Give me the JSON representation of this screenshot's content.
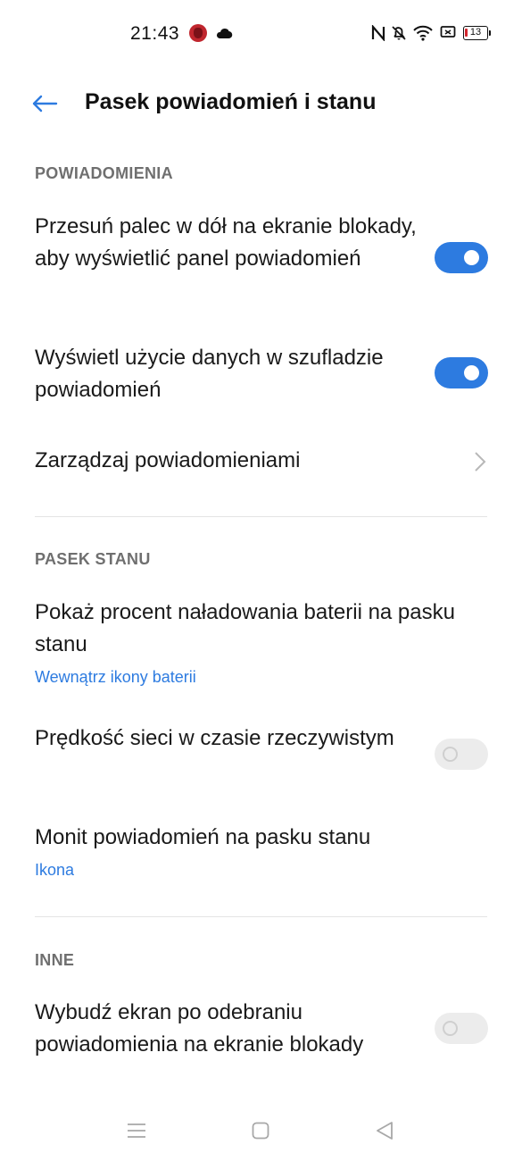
{
  "status_bar": {
    "time": "21:43",
    "battery_level": "13",
    "icons": [
      "game-app-icon",
      "cloud-icon",
      "nfc-icon",
      "bell-off-icon",
      "wifi-icon",
      "cast-icon",
      "battery-icon"
    ]
  },
  "header": {
    "title": "Pasek powiadomień i stanu",
    "back_icon": "arrow-left-icon"
  },
  "sections": {
    "notifications": {
      "title": "POWIADOMIENIA",
      "items": [
        {
          "title": "Przesuń palec w dół na ekranie blokady, aby wyświetlić panel powiadomień",
          "toggle": true
        },
        {
          "title": "Wyświetl użycie danych w szufladzie powiadomień",
          "toggle": true
        },
        {
          "title": "Zarządzaj powiadomieniami",
          "chevron": true
        }
      ]
    },
    "status_bar_section": {
      "title": "PASEK STANU",
      "items": [
        {
          "title": "Pokaż procent naładowania baterii na pasku stanu",
          "subtitle": "Wewnątrz ikony baterii"
        },
        {
          "title": "Prędkość sieci w czasie rzeczywistym",
          "toggle": false
        },
        {
          "title": "Monit powiadomień na pasku stanu",
          "subtitle": "Ikona"
        }
      ]
    },
    "other": {
      "title": "INNE",
      "items": [
        {
          "title": "Wybudź ekran po odebraniu powiadomienia na ekranie blokady",
          "toggle": false
        }
      ]
    }
  },
  "colors": {
    "accent": "#2d7be0",
    "section_header": "#6f6f6f",
    "toggle_off": "#ececec"
  },
  "nav_bar": {
    "icons": [
      "menu-icon",
      "home-icon",
      "back-icon"
    ]
  }
}
